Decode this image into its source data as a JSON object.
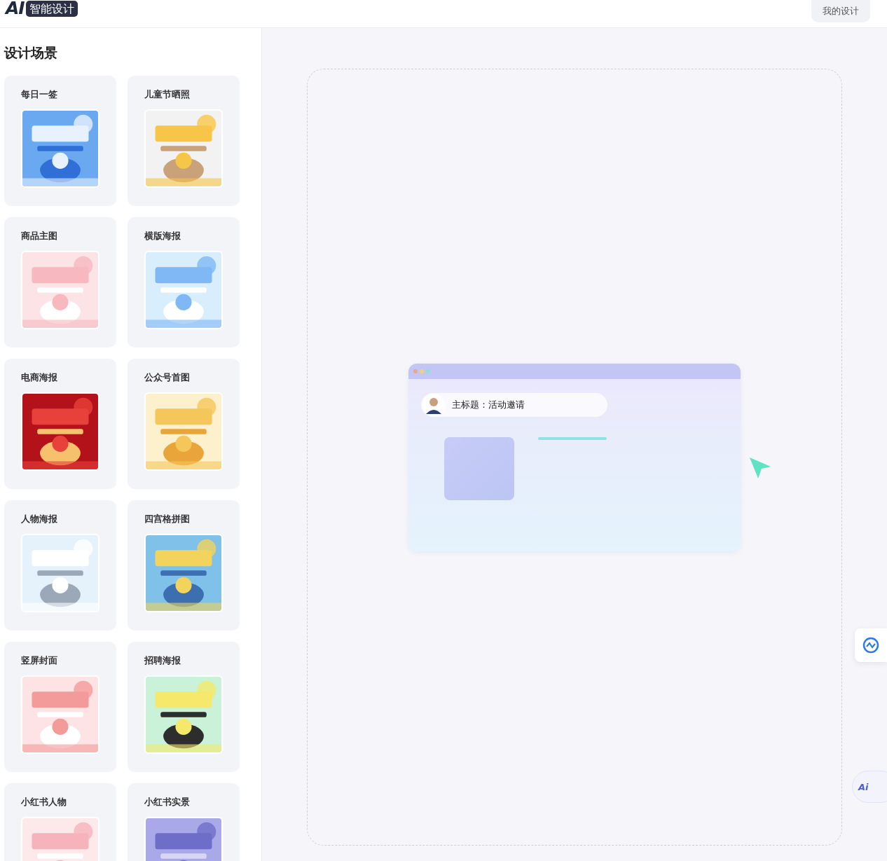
{
  "header": {
    "logo_mark": "AI",
    "logo_text": "智能设计",
    "my_designs_button": "我的设计"
  },
  "sidebar": {
    "title": "设计场景",
    "scenes": [
      {
        "label": "每日一签"
      },
      {
        "label": "儿童节晒照"
      },
      {
        "label": "商品主图"
      },
      {
        "label": "横版海报"
      },
      {
        "label": "电商海报"
      },
      {
        "label": "公众号首图"
      },
      {
        "label": "人物海报"
      },
      {
        "label": "四宫格拼图"
      },
      {
        "label": "竖屏封面"
      },
      {
        "label": "招聘海报"
      },
      {
        "label": "小红书人物"
      },
      {
        "label": "小红书实景"
      }
    ]
  },
  "canvas": {
    "prompt_text": "主标题：活动邀请"
  },
  "floating": {
    "ai_button": "Ai"
  }
}
